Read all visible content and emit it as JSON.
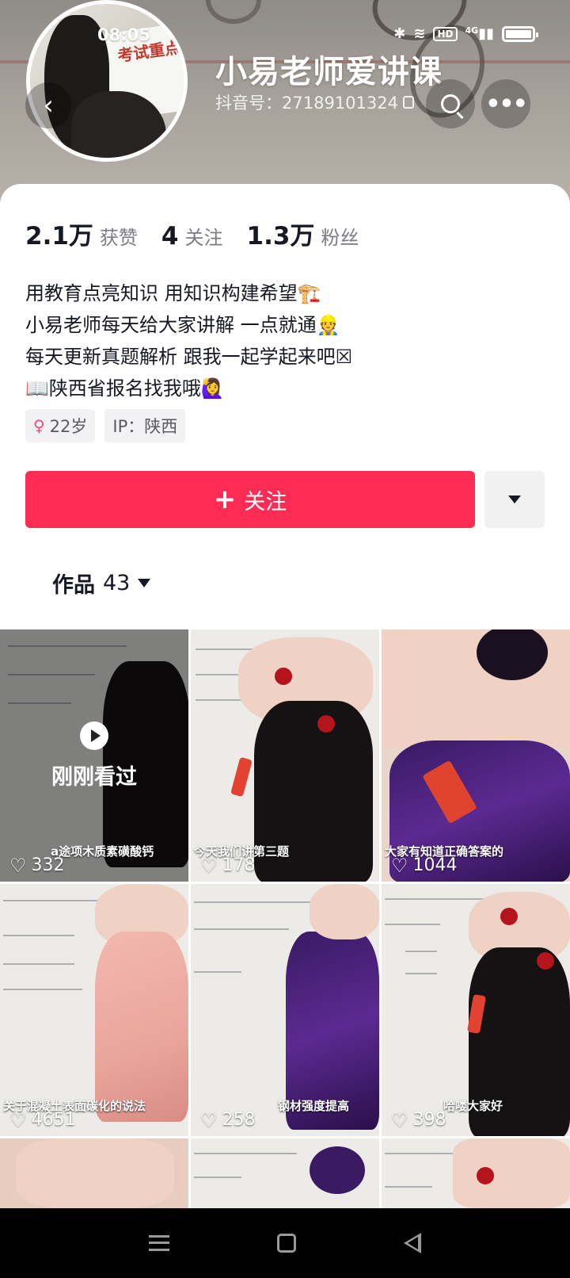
{
  "status_bar": {
    "time": "08:05",
    "network": "4G",
    "hd": "HD"
  },
  "profile": {
    "nickname": "小易老师爱讲课",
    "douyin_id": "抖音号：27189101324",
    "avatar_text": "考试重点"
  },
  "stats": [
    {
      "value": "2.1万",
      "label": "获赞"
    },
    {
      "value": "4",
      "label": "关注"
    },
    {
      "value": "1.3万",
      "label": "粉丝"
    }
  ],
  "bio": [
    "用教育点亮知识 用知识构建希望🏗️",
    "小易老师每天给大家讲解 一点就通👷",
    "每天更新真题解析 跟我一起学起来吧☒",
    "📖陕西省报名找我哦🙋‍♀️"
  ],
  "tags": [
    {
      "icon": "female-icon",
      "text": "22岁"
    },
    {
      "text": "IP：陕西"
    }
  ],
  "actions": {
    "follow_label": "关注",
    "follow_color": "#fe2c55"
  },
  "works_tab": {
    "label": "作品",
    "count": "43"
  },
  "grid": [
    {
      "caption": "a途项木质素磺酸钙",
      "likes": "332",
      "watched": "刚刚看过",
      "style": "watched"
    },
    {
      "caption": "今天我们讲第三题",
      "likes": "178",
      "style": "black"
    },
    {
      "caption": "大家有知道正确答案的",
      "likes": "1044",
      "style": "purple"
    },
    {
      "caption": "关于混凝土表面碳化的说法",
      "likes": "4651",
      "style": "pink"
    },
    {
      "caption": "钢材强度提高",
      "likes": "258",
      "style": "purple2"
    },
    {
      "caption": "哈喽大家好",
      "likes": "398",
      "style": "black2"
    },
    {
      "caption": "",
      "likes": "",
      "style": "skin"
    },
    {
      "caption": "",
      "likes": "",
      "style": "purple3"
    },
    {
      "caption": "",
      "likes": "",
      "style": "black3"
    }
  ],
  "colors": {
    "accent": "#fe2c55",
    "text_primary": "#161823",
    "text_secondary": "#7b7c82"
  }
}
